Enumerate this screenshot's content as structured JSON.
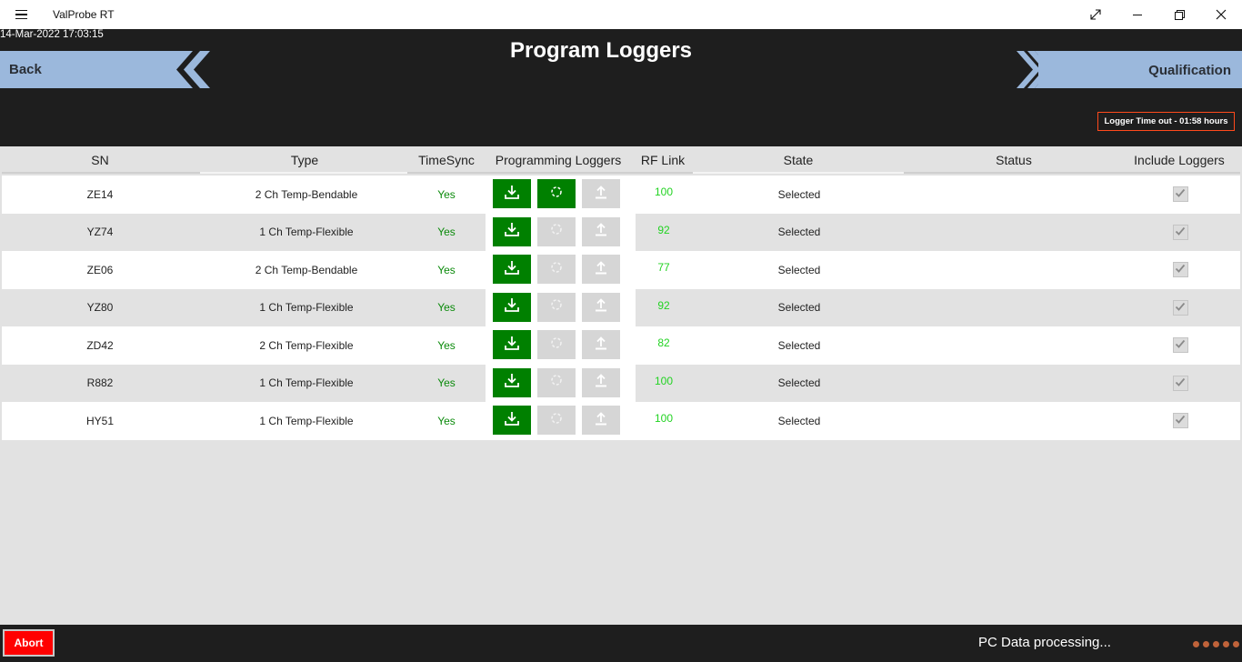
{
  "window": {
    "app_title": "ValProbe RT",
    "icons": [
      "hamburger-icon",
      "fullscreen-icon",
      "minimize-icon",
      "restore-icon",
      "close-icon"
    ]
  },
  "header": {
    "datetime": "14-Mar-2022 17:03:15",
    "title": "Program Loggers",
    "back_label": "Back",
    "next_label": "Qualification",
    "timeout_text": "Logger Time out - 01:58 hours"
  },
  "table": {
    "columns": [
      "SN",
      "Type",
      "TimeSync",
      "Programming Loggers",
      "RF Link",
      "State",
      "Status",
      "Include Loggers"
    ],
    "rows": [
      {
        "sn": "ZE14",
        "type": "2 Ch Temp-Bendable",
        "timesync": "Yes",
        "rf": "100",
        "state": "Selected",
        "status": "",
        "include": true,
        "sync_active": true
      },
      {
        "sn": "YZ74",
        "type": "1 Ch Temp-Flexible",
        "timesync": "Yes",
        "rf": "92",
        "state": "Selected",
        "status": "",
        "include": true,
        "sync_active": false
      },
      {
        "sn": "ZE06",
        "type": "2 Ch Temp-Bendable",
        "timesync": "Yes",
        "rf": "77",
        "state": "Selected",
        "status": "",
        "include": true,
        "sync_active": false
      },
      {
        "sn": "YZ80",
        "type": "1 Ch Temp-Flexible",
        "timesync": "Yes",
        "rf": "92",
        "state": "Selected",
        "status": "",
        "include": true,
        "sync_active": false
      },
      {
        "sn": "ZD42",
        "type": "2 Ch Temp-Flexible",
        "timesync": "Yes",
        "rf": "82",
        "state": "Selected",
        "status": "",
        "include": true,
        "sync_active": false
      },
      {
        "sn": "R882",
        "type": "1 Ch Temp-Flexible",
        "timesync": "Yes",
        "rf": "100",
        "state": "Selected",
        "status": "",
        "include": true,
        "sync_active": false
      },
      {
        "sn": "HY51",
        "type": "1 Ch Temp-Flexible",
        "timesync": "Yes",
        "rf": "100",
        "state": "Selected",
        "status": "",
        "include": true,
        "sync_active": false
      }
    ]
  },
  "footer": {
    "abort_label": "Abort",
    "status_text": "PC Data processing..."
  },
  "colors": {
    "header_bg": "#1e1e1e",
    "nav_button": "#9bb8dc",
    "program_green": "#008000",
    "disabled_grey": "#d6d6d6",
    "timesync_green": "#0a8a0a",
    "rf_green": "#22d322",
    "timeout_border": "#ff4a1c",
    "abort_red": "#ff0000"
  }
}
